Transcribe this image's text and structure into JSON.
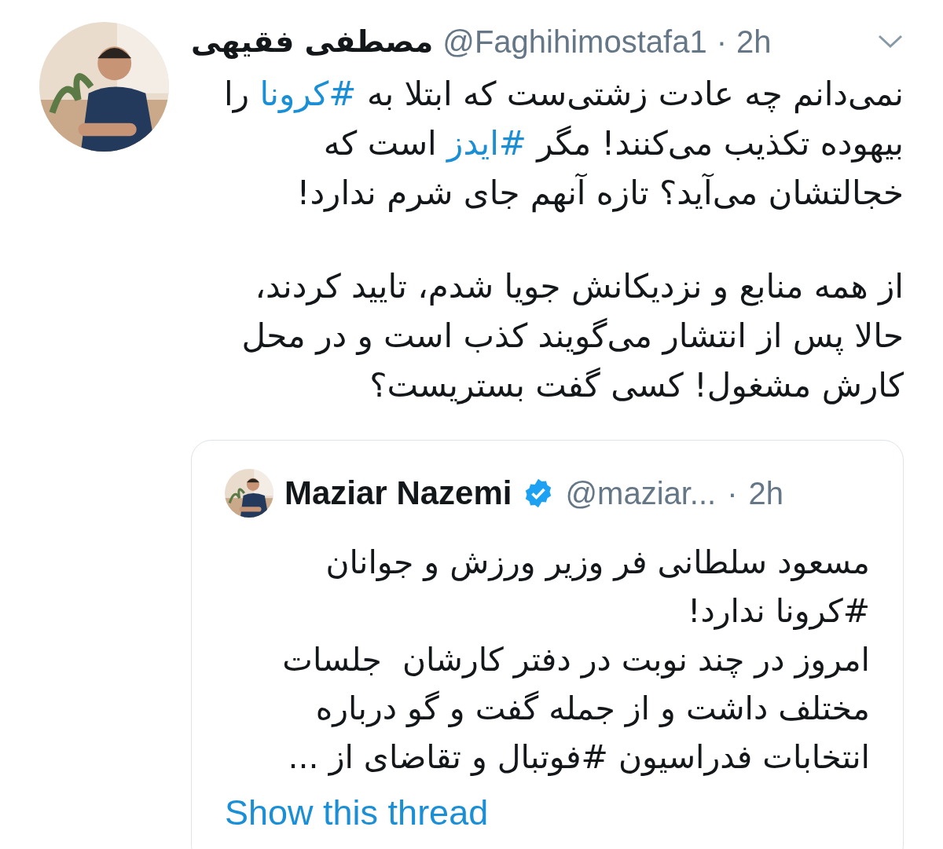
{
  "tweet": {
    "author_name": "مصطفی فقیهی",
    "handle": "@Faghihimostafa1",
    "separator": "·",
    "time": "2h",
    "paragraphs": [
      [
        [
          {
            "kind": "text",
            "text": "نمی‌دانم چه عادت زشتی‌ست که ابتلا به "
          },
          {
            "kind": "hashtag",
            "text": "#کرونا"
          },
          {
            "kind": "text",
            "text": " را"
          }
        ],
        [
          {
            "kind": "text",
            "text": "بیهوده تکذیب می‌کنند! مگر "
          },
          {
            "kind": "hashtag",
            "text": "#ایدز"
          },
          {
            "kind": "text",
            "text": " است که"
          }
        ],
        [
          {
            "kind": "text",
            "text": "خجالتشان می‌آید؟ تازه آنهم جای شرم ندارد!"
          }
        ]
      ],
      [
        [
          {
            "kind": "text",
            "text": "از همه منابع و نزدیکانش جویا شدم، تایید کردند،"
          }
        ],
        [
          {
            "kind": "text",
            "text": "حالا پس از انتشار می‌گویند کذب است و در محل"
          }
        ],
        [
          {
            "kind": "text",
            "text": "کارش مشغول! کسی گفت بستریست؟"
          }
        ]
      ]
    ],
    "quoted": {
      "author_name": "Maziar Nazemi",
      "verified": true,
      "handle": "@maziar...",
      "separator": "·",
      "time": "2h",
      "lines": [
        "مسعود سلطانی فر وزیر ورزش و جوانان",
        "#کرونا ندارد!",
        "امروز در چند نوبت در دفتر کارشان  جلسات",
        "مختلف داشت و از جمله گفت و گو درباره",
        "انتخابات فدراسیون #فوتبال و تقاضای از ..."
      ]
    },
    "thread_link": "Show this thread"
  }
}
